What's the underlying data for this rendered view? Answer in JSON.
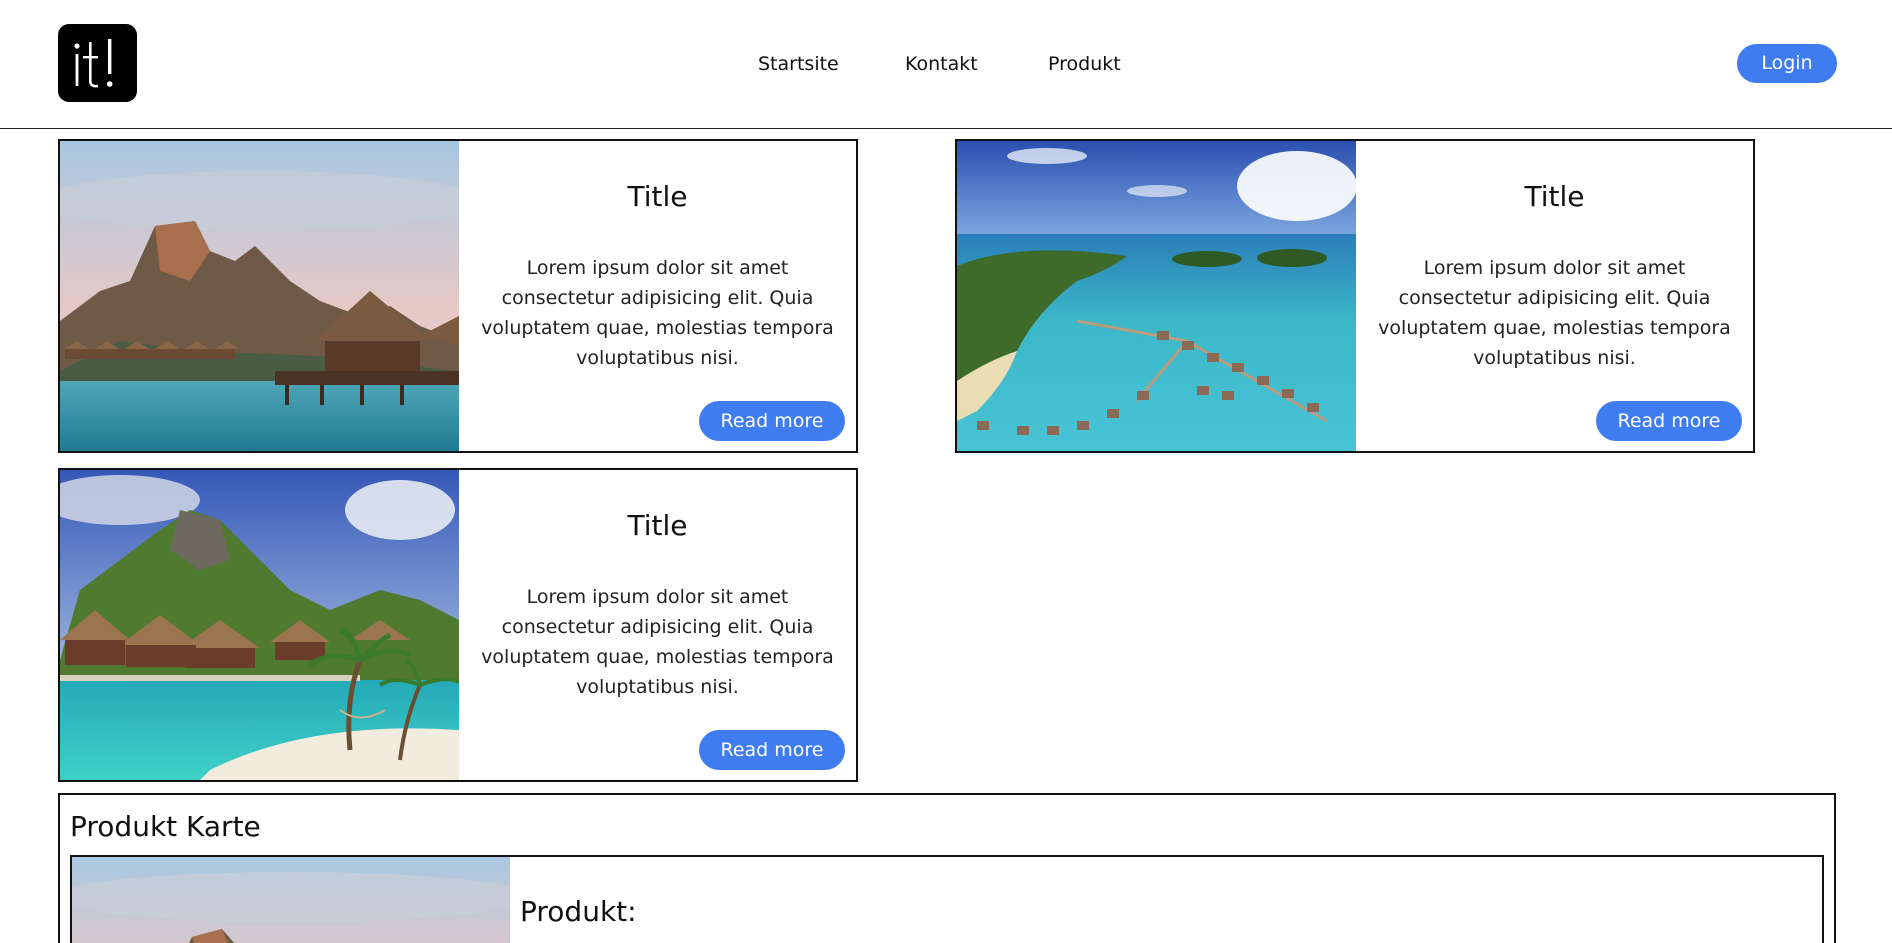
{
  "header": {
    "logo_text": "it!",
    "nav": [
      "Startsite",
      "Kontakt",
      "Produkt"
    ],
    "login_label": "Login"
  },
  "cards": [
    {
      "title": "Title",
      "text": "Lorem ipsum dolor sit amet consectetur adipisicing elit. Quia voluptatem quae, molestias tempora voluptatibus nisi.",
      "button_label": "Read more",
      "image": "tropical-mountain-bungalows-image"
    },
    {
      "title": "Title",
      "text": "Lorem ipsum dolor sit amet consectetur adipisicing elit. Quia voluptatem quae, molestias tempora voluptatibus nisi.",
      "button_label": "Read more",
      "image": "aerial-lagoon-bungalows-image"
    },
    {
      "title": "Title",
      "text": "Lorem ipsum dolor sit amet consectetur adipisicing elit. Quia voluptatem quae, molestias tempora voluptatibus nisi.",
      "button_label": "Read more",
      "image": "beach-bungalows-palm-image"
    }
  ],
  "produkt": {
    "heading": "Produkt Karte",
    "label": "Produkt:"
  },
  "colors": {
    "accent": "#3e7cf0",
    "border": "#111111",
    "logo_bg": "#000000"
  }
}
